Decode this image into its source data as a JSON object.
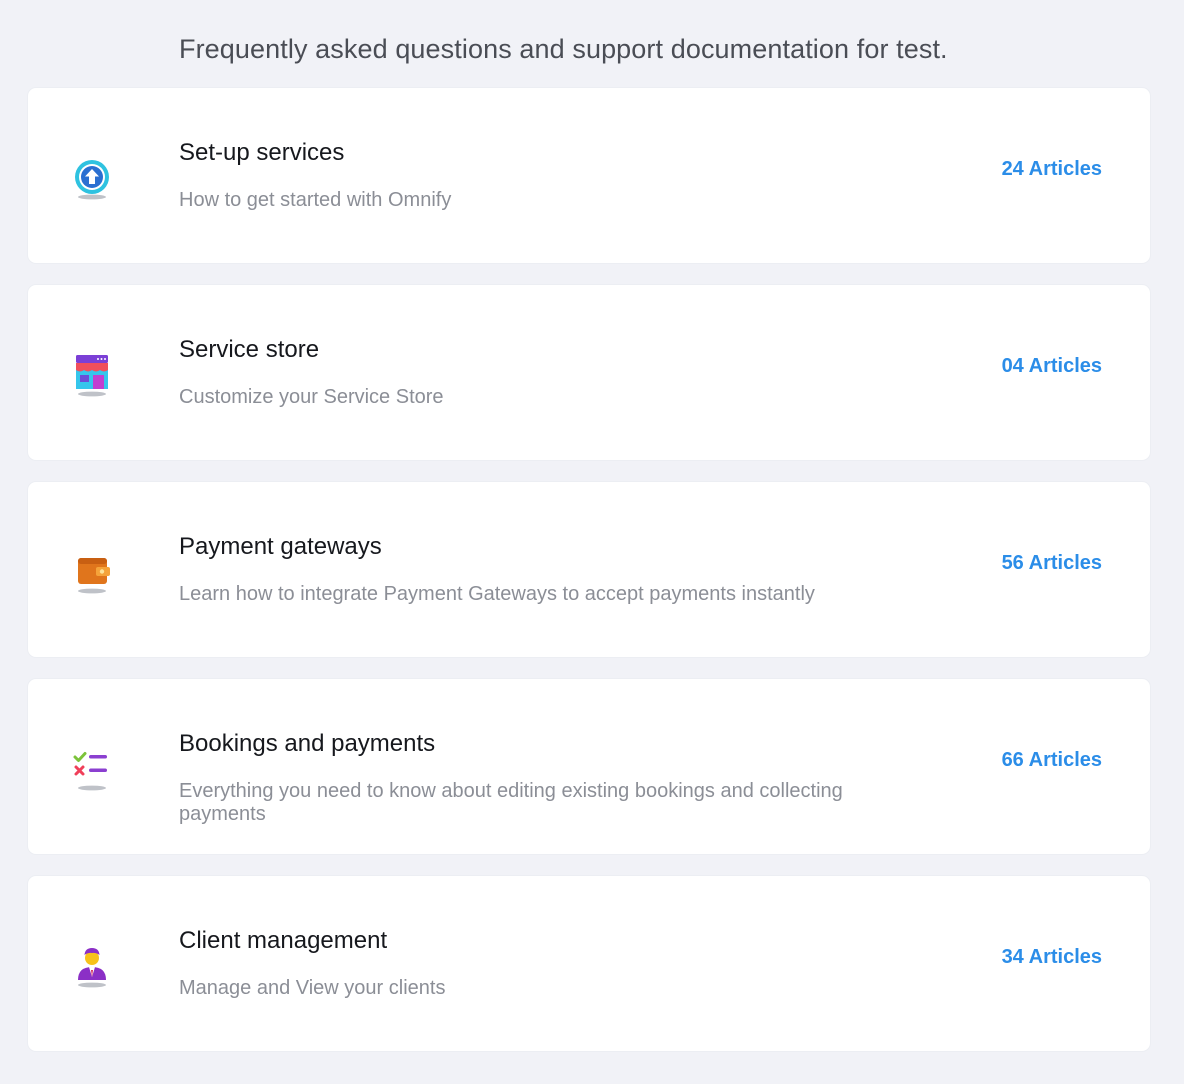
{
  "header": {
    "intro": "Frequently asked questions and support documentation for test."
  },
  "categories": [
    {
      "title": "Set-up services",
      "description": "How to get started with Omnify",
      "count": "24 Articles",
      "icon": "upload-arrow-icon"
    },
    {
      "title": "Service store",
      "description": "Customize your Service Store",
      "count": "04 Articles",
      "icon": "storefront-icon"
    },
    {
      "title": "Payment gateways",
      "description": "Learn how to integrate Payment Gateways to accept payments instantly",
      "count": "56 Articles",
      "icon": "wallet-icon"
    },
    {
      "title": "Bookings and payments",
      "description": "Everything you need to know about editing existing bookings and collecting payments",
      "count": "66 Articles",
      "icon": "checklist-icon"
    },
    {
      "title": "Client management",
      "description": "Manage and View your clients",
      "count": "34 Articles",
      "icon": "client-person-icon"
    }
  ],
  "colors": {
    "background": "#f1f2f7",
    "card": "#ffffff",
    "accent": "#2b8de8",
    "title": "#16181d",
    "description": "#8b8e96"
  }
}
